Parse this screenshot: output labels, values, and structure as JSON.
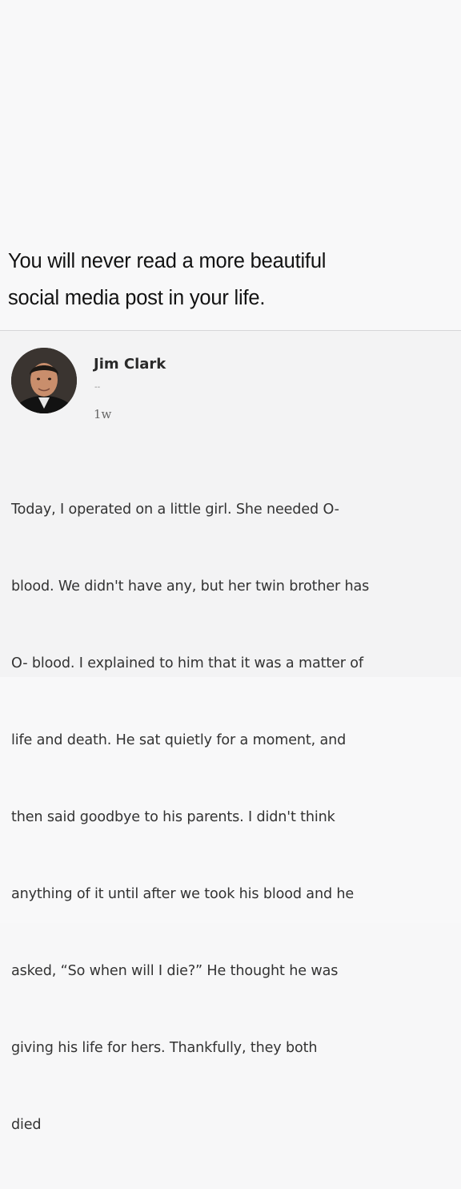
{
  "headline": {
    "line1": "You will never read a more beautiful",
    "line2": "social media post in your life."
  },
  "post": {
    "author": "Jim Clark",
    "subline": "--",
    "time": "1w",
    "avatar_icon": "profile-photo",
    "lines": [
      "Today, I operated on a little girl. She needed O-",
      "blood. We didn't have any, but her twin brother has",
      "O- blood. I explained to him that it was a matter of",
      "life and death. He sat quietly for a moment, and",
      "then said goodbye to his parents. I didn't think",
      "anything of it until after we took his blood and he",
      "asked, “So when will I die?” He thought he was",
      "giving his life for hers. Thankfully, they both",
      "died"
    ]
  }
}
